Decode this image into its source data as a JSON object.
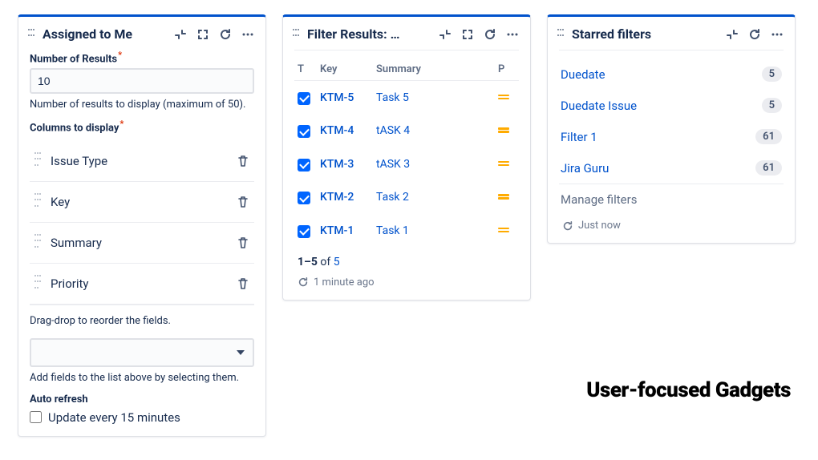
{
  "caption": "User-focused Gadgets",
  "gadgets": {
    "assigned": {
      "title": "Assigned to Me",
      "numResultsLabel": "Number of Results",
      "numResultsValue": "10",
      "numResultsHelp": "Number of results to display (maximum of 50).",
      "columnsLabel": "Columns to display",
      "columns": [
        "Issue Type",
        "Key",
        "Summary",
        "Priority"
      ],
      "dragHelp": "Drag-drop to reorder the fields.",
      "addHelp": "Add fields to the list above by selecting them.",
      "autoLabel": "Auto refresh",
      "autoOption": "Update every 15 minutes"
    },
    "filter": {
      "title": "Filter Results: …",
      "headers": {
        "t": "T",
        "key": "Key",
        "summary": "Summary",
        "p": "P"
      },
      "rows": [
        {
          "key": "KTM-5",
          "summary": "Task 5"
        },
        {
          "key": "KTM-4",
          "summary": "tASK 4"
        },
        {
          "key": "KTM-3",
          "summary": "tASK 3"
        },
        {
          "key": "KTM-2",
          "summary": "Task 2"
        },
        {
          "key": "KTM-1",
          "summary": "Task 1"
        }
      ],
      "pager": {
        "range": "1–5",
        "of": " of ",
        "total": "5"
      },
      "updated": "1 minute ago"
    },
    "starred": {
      "title": "Starred filters",
      "items": [
        {
          "name": "Duedate",
          "count": "5"
        },
        {
          "name": "Duedate Issue",
          "count": "5"
        },
        {
          "name": "Filter 1",
          "count": "61"
        },
        {
          "name": "Jira Guru",
          "count": "61"
        }
      ],
      "manage": "Manage filters",
      "updated": "Just now"
    }
  }
}
